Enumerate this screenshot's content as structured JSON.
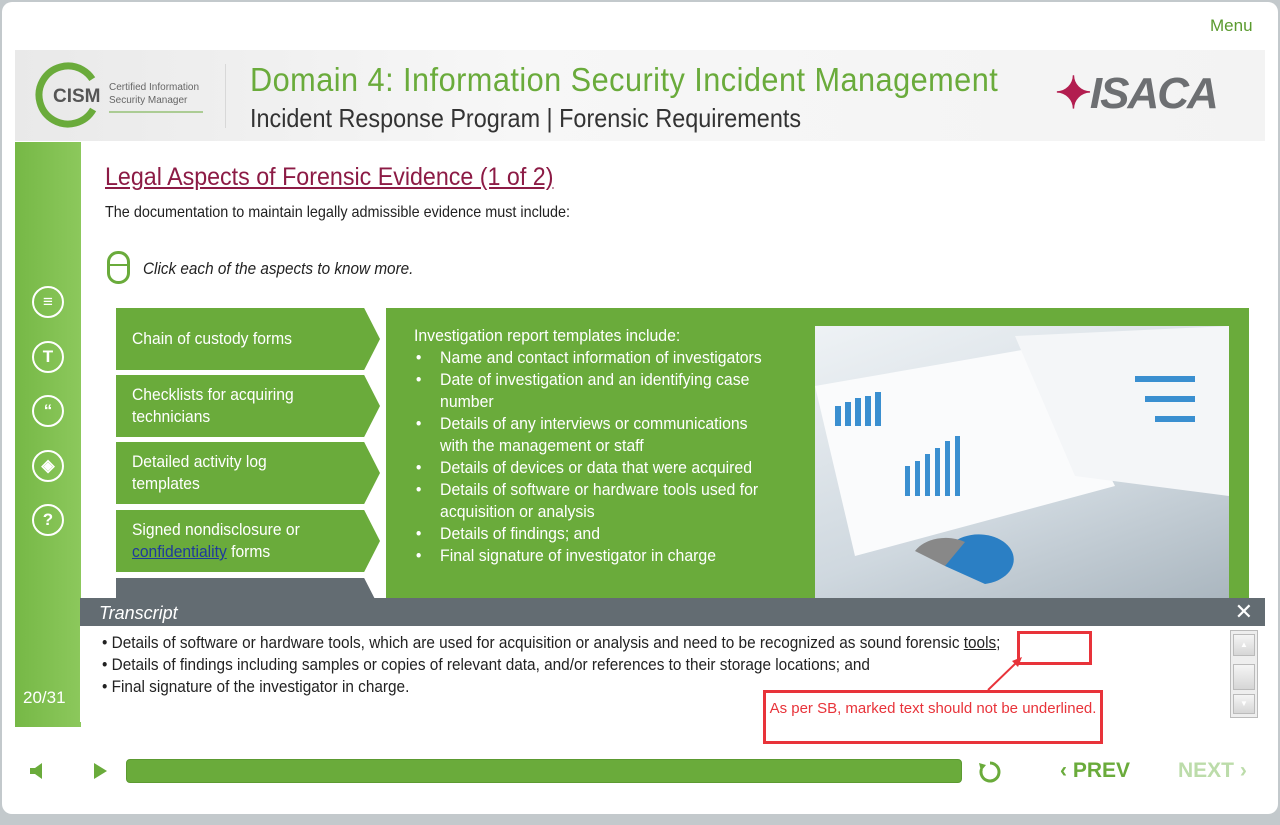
{
  "menu_label": "Menu",
  "header": {
    "logo_text": "CISM",
    "logo_subtext": "Certified Information Security Manager",
    "title": "Domain 4: Information Security Incident Management",
    "subtitle": "Incident Response Program | Forensic Requirements",
    "brand": "ISACA"
  },
  "sidebar": {
    "icons": [
      "notes-icon",
      "text-icon",
      "quote-icon",
      "layers-icon",
      "help-icon"
    ],
    "page_indicator": "20/31"
  },
  "content": {
    "heading": "Legal Aspects of Forensic Evidence (1 of 2)",
    "intro": "The documentation to maintain legally admissible evidence must include:",
    "instruction": "Click each of the aspects to know more.",
    "tabs": [
      {
        "label": "Chain of custody forms"
      },
      {
        "label": "Checklists for acquiring technicians"
      },
      {
        "label": "Detailed activity log templates"
      },
      {
        "label_before": "Signed nondisclosure or ",
        "link": "confidentiality",
        "label_after": " forms"
      }
    ],
    "panel": {
      "lead": "Investigation report templates include:",
      "bullets": [
        "Name and contact information of investigators",
        "Date of investigation and an identifying case number",
        "Details of any interviews or communications with the management or staff",
        "Details of devices or data that were acquired",
        "Details of software or hardware tools used for acquisition or analysis",
        "Details of findings; and",
        "Final signature of investigator in charge"
      ]
    }
  },
  "transcript": {
    "title": "Transcript",
    "lines": [
      {
        "text": "• Details of software or hardware tools, which are used for acquisition or analysis and need to be recognized as sound forensic ",
        "underlined": "tools",
        "after": ";"
      },
      {
        "text": "• Details of findings including samples or copies of relevant data, and/or references to their storage locations; and"
      },
      {
        "text": "• Final signature of the investigator in charge."
      }
    ]
  },
  "annotation": "As per SB, marked text should not be underlined.",
  "controls": {
    "prev": "PREV",
    "next": "NEXT",
    "progress_percent": 100
  },
  "colors": {
    "accent": "#6aab3b",
    "heading": "#8c1b45",
    "annotation": "#e8333a",
    "bar": "#636c72"
  }
}
